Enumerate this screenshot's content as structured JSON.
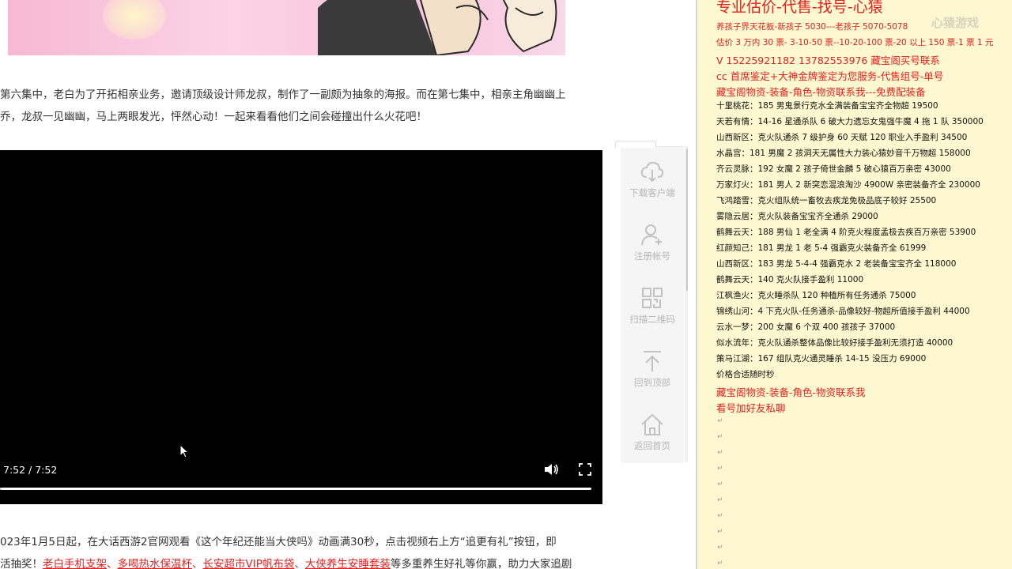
{
  "article": {
    "para1": [
      "第六集中，老白为了开拓相亲业务，邀请顶级设计师龙叔，制作了一副颇为抽象的海报。而在第七集中，相亲主角幽幽上",
      "乔，龙叔一见幽幽，马上两眼发光，怦然心动！一起来看看他们之间会碰撞出什么火花吧！"
    ],
    "para2_line1": "023年1月5日起，在大话西游2官网观看《这个年纪还能当大侠吗》动画满30秒，点击视频右上方“追更有礼”按钮，即",
    "para2_line2_prefix": "活抽奖！",
    "para2_links": [
      "老白手机支架",
      "多喝热水保温杯",
      "长安超市VIP帆布袋",
      "大侠养生安睡套装"
    ],
    "para2_line2_suffix": "等多重养生好礼等你赢，助力大家追剧"
  },
  "video": {
    "time": "7:52 / 7:52",
    "progress": 1.0
  },
  "sidebar": {
    "items": [
      {
        "label": "下载客户端",
        "icon": "cloud-download-icon"
      },
      {
        "label": "注册帐号",
        "icon": "user-add-icon"
      },
      {
        "label": "扫描二维码",
        "icon": "qr-code-icon"
      },
      {
        "label": "回到顶部",
        "icon": "back-to-top-icon"
      },
      {
        "label": "返回首页",
        "icon": "home-icon"
      }
    ]
  },
  "doc": {
    "headline": "专业估价-代售-找号-心猿",
    "lines": [
      {
        "text": "养孩子界天花板-新孩子 5030---老孩子 5070-5078",
        "red": true
      },
      {
        "text": "估价 3 万内 30 票- 3-10-50 票--10-20-100 票-20 以上 150 票-1 票 1 元",
        "red": true
      },
      {
        "text": "V 15225921182       13782553976      藏宝阁买号联系",
        "red": true,
        "big": true
      },
      {
        "text": "cc 首席鉴定+大神金牌鉴定为您服务-代售组号-单号",
        "red": true,
        "big": true
      },
      {
        "text": "藏宝阁物资-装备-角色-物资联系我---免费配装备",
        "red": true,
        "big": true
      },
      {
        "text": "十里桃花：185 男鬼景行克水全满装备宝宝齐全物超 19500"
      },
      {
        "text": "天若有情：14-16 星通杀队 6 破大力遗忘女鬼强牛魔 4 拖 1 队 350000"
      },
      {
        "text": "山西新区：克火队通杀 7 级护身 60 天赋 120 职业入手盈利 34500"
      },
      {
        "text": "水晶宫：181 男魔 2 孩洞天无属性大力装心猿妙音千万物超 158000"
      },
      {
        "text": "齐云灵脉：192 女魔 2 孩子倚世金麟 5 破心猿百万亲密 43000"
      },
      {
        "text": "万家灯火：181 男人 2 新突恋混浪淘沙 4900W 亲密装备齐全 230000"
      },
      {
        "text": "飞鸿踏雪：克火组队统一畜牧去疾龙免极品底子较好 25500"
      },
      {
        "text": "雾隐云居：克火队装备宝宝齐全通杀 29000"
      },
      {
        "text": "鹤舞云天：188 男仙 1 老全满 4 阶克火程度孟极去疾百万亲密 53900"
      },
      {
        "text": "红颜知己：181 男龙 1 老 5-4 强霸克火装备齐全 61999"
      },
      {
        "text": "山西新区：183 男龙 5-4-4 强霸克水 2 老装备宝宝齐全 118000"
      },
      {
        "text": "鹤舞云天：140 克火队接手盈利 11000"
      },
      {
        "text": "江枫渔火：克火睡杀队 120 种植所有任务通杀 75000"
      },
      {
        "text": "锦绣山河：4 下克火队-任务通杀-品像较好-物超所值接手盈利 44000"
      },
      {
        "text": "云水一梦：200 女魔 6 个双 400 孩孩子 37000"
      },
      {
        "text": "似水流年：克火队通杀整体品像比较好接手盈利无须打造 40000"
      },
      {
        "text": "策马江湖：167 组队克火通灵睡杀 14-15 没压力 69000"
      },
      {
        "text": "价格合适随时秒"
      },
      {
        "text": "藏宝阁物资-装备-角色-物资联系我",
        "red": true,
        "big": true
      },
      {
        "text": "看号加好友私聊",
        "red": true,
        "big": true
      }
    ],
    "watermark": "心猿游戏"
  }
}
